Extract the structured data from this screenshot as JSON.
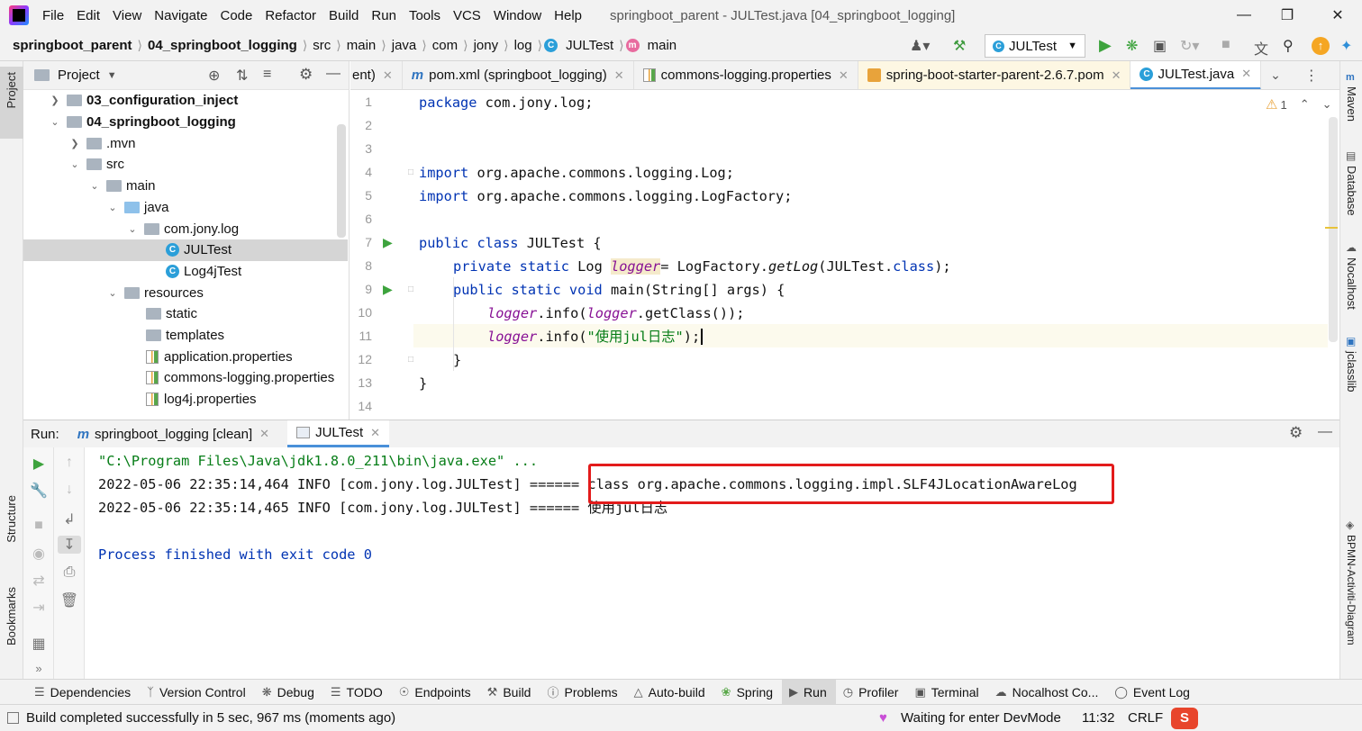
{
  "menubar": {
    "items": [
      "File",
      "Edit",
      "View",
      "Navigate",
      "Code",
      "Refactor",
      "Build",
      "Run",
      "Tools",
      "VCS",
      "Window",
      "Help"
    ],
    "window_title": "springboot_parent - JULTest.java [04_springboot_logging]"
  },
  "breadcrumbs": [
    "springboot_parent",
    "04_springboot_logging",
    "src",
    "main",
    "java",
    "com",
    "jony",
    "log",
    "JULTest",
    "main"
  ],
  "run_config": "JULTest",
  "project_panel": {
    "title": "Project",
    "tree": [
      {
        "label": "03_configuration_inject",
        "bold": true
      },
      {
        "label": "04_springboot_logging",
        "bold": true
      },
      {
        "label": ".mvn"
      },
      {
        "label": "src"
      },
      {
        "label": "main"
      },
      {
        "label": "java"
      },
      {
        "label": "com.jony.log"
      },
      {
        "label": "JULTest"
      },
      {
        "label": "Log4jTest"
      },
      {
        "label": "resources"
      },
      {
        "label": "static"
      },
      {
        "label": "templates"
      },
      {
        "label": "application.properties"
      },
      {
        "label": "commons-logging.properties"
      },
      {
        "label": "log4j.properties"
      }
    ]
  },
  "editor_tabs": [
    {
      "label": "ent)"
    },
    {
      "label": "pom.xml (springboot_logging)"
    },
    {
      "label": "commons-logging.properties"
    },
    {
      "label": "spring-boot-starter-parent-2.6.7.pom"
    },
    {
      "label": "JULTest.java"
    }
  ],
  "editor": {
    "warnings_count": "1",
    "line_numbers": [
      "1",
      "2",
      "3",
      "4",
      "5",
      "6",
      "7",
      "8",
      "9",
      "10",
      "11",
      "12",
      "13",
      "14"
    ],
    "code": {
      "l1_kw": "package",
      "l1_rest": " com.jony.log;",
      "l4_kw": "import",
      "l4_rest": " org.apache.commons.logging.Log;",
      "l5_kw": "import",
      "l5_rest": " org.apache.commons.logging.LogFactory;",
      "l7_kw": "public class",
      "l7_rest": " JULTest {",
      "l8_kw": "private static",
      "l8_type": " Log ",
      "l8_field": "logger",
      "l8_eq": "= LogFactory.",
      "l8_method": "getLog",
      "l8_arg": "(JULTest.",
      "l8_kw2": "class",
      "l8_end": ");",
      "l9_kw": "public static void",
      "l9_rest": " main(String[] args) {",
      "l10_field": "logger",
      "l10_a": ".info(",
      "l10_field2": "logger",
      "l10_b": ".getClass());",
      "l11_field": "logger",
      "l11_a": ".info(",
      "l11_str": "\"使用jul日志\"",
      "l11_b": ");",
      "l12": "}",
      "l13": "}"
    }
  },
  "run_panel": {
    "label": "Run:",
    "tabs": [
      "springboot_logging [clean]",
      "JULTest"
    ],
    "output": [
      "\"C:\\Program Files\\Java\\jdk1.8.0_211\\bin\\java.exe\" ...",
      "2022-05-06 22:35:14,464 INFO [com.jony.log.JULTest] ====== class org.apache.commons.logging.impl.SLF4JLocationAwareLog",
      "2022-05-06 22:35:14,465 INFO [com.jony.log.JULTest] ====== 使用jul日志",
      "",
      "Process finished with exit code 0"
    ]
  },
  "left_strip": [
    "Project",
    "Structure",
    "Bookmarks"
  ],
  "right_strip": [
    "Maven",
    "Database",
    "Nocalhost",
    "jclasslib",
    "BPMN-Activiti-Diagram"
  ],
  "tool_windows": [
    "Dependencies",
    "Version Control",
    "Debug",
    "TODO",
    "Endpoints",
    "Build",
    "Problems",
    "Auto-build",
    "Spring",
    "Run",
    "Profiler",
    "Terminal",
    "Nocalhost Co...",
    "Event Log"
  ],
  "statusbar": {
    "message": "Build completed successfully in 5 sec, 967 ms (moments ago)",
    "devmode": "Waiting for enter DevMode",
    "position": "11:32",
    "line_sep": "CRLF"
  },
  "colors": {
    "keyword": "#0033b3",
    "field": "#871094",
    "string": "#067d17",
    "highlight_box": "#e31b1b",
    "accent": "#4a90d9"
  }
}
